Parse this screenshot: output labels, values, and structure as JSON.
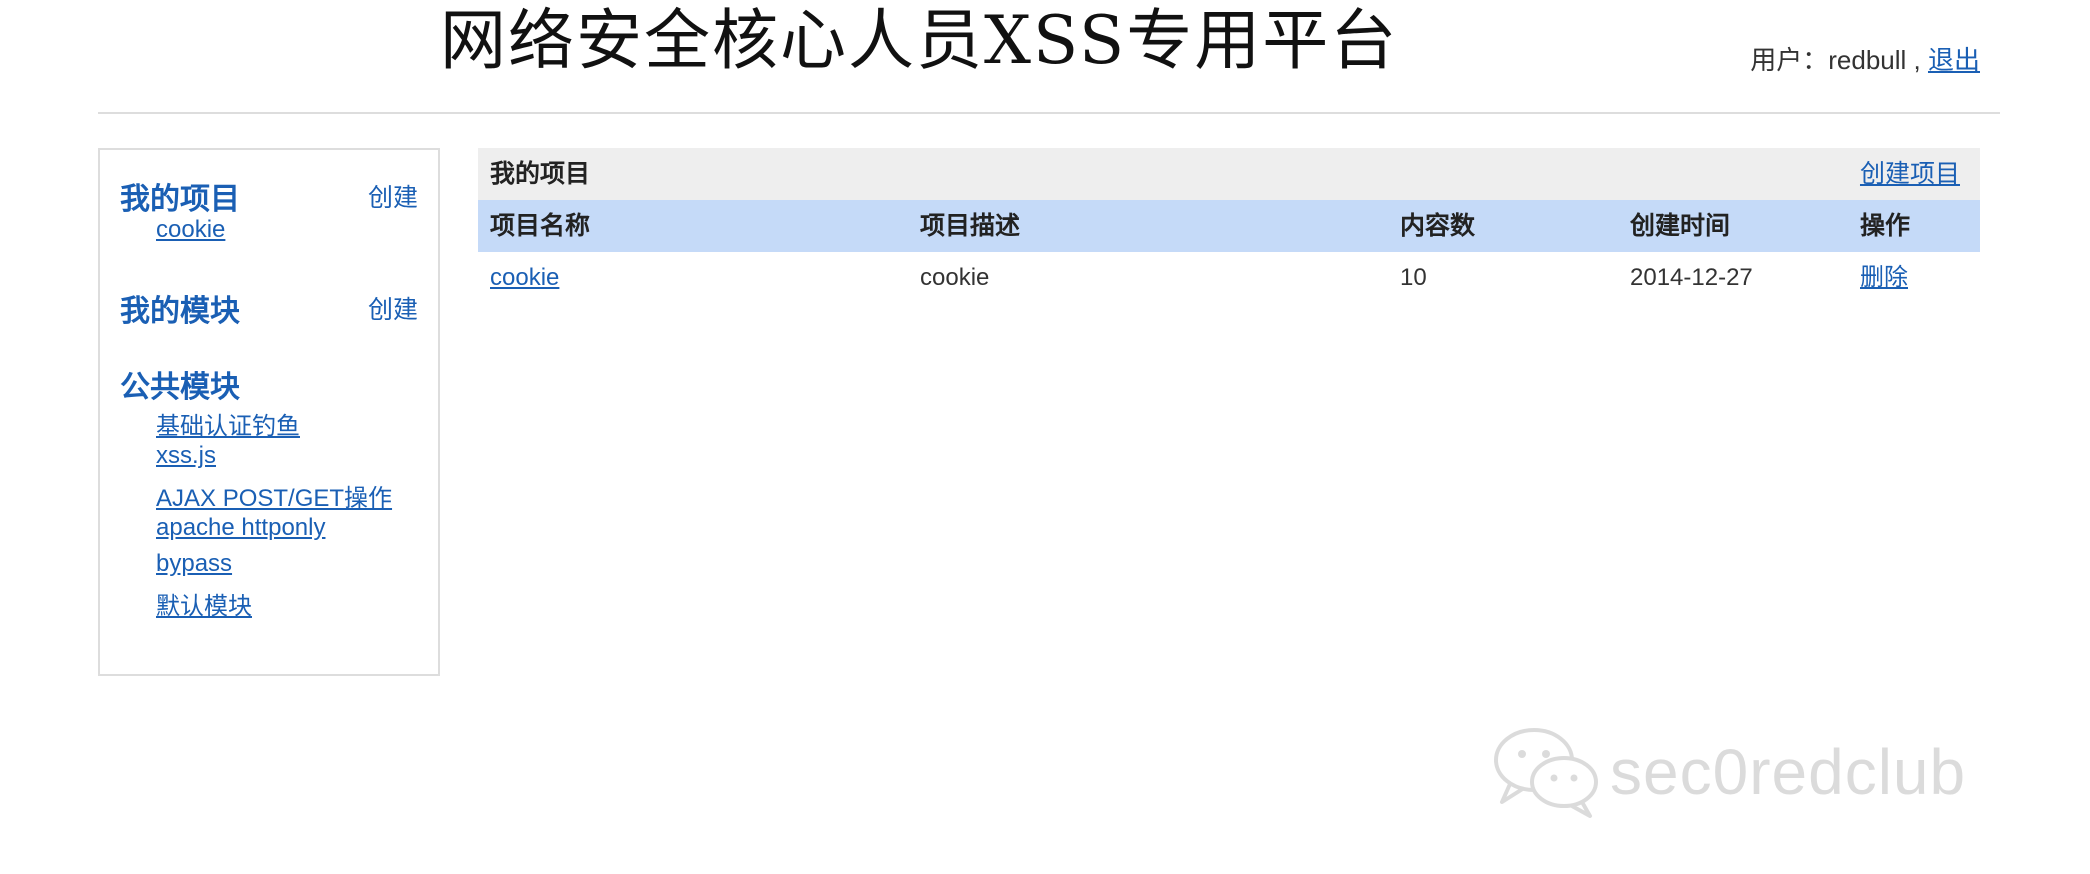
{
  "header": {
    "title": "网络安全核心人员XSS专用平台",
    "user_prefix": "用户：",
    "username": "redbull",
    "separator": " , ",
    "logout_label": "退出"
  },
  "sidebar": {
    "my_projects": {
      "title": "我的项目",
      "create_label": "创建",
      "items": [
        "cookie"
      ]
    },
    "my_modules": {
      "title": "我的模块",
      "create_label": "创建"
    },
    "public_modules": {
      "title": "公共模块",
      "items": [
        "基础认证钓鱼",
        "xss.js",
        "AJAX POST/GET操作",
        "apache httponly",
        "bypass",
        "默认模块"
      ]
    }
  },
  "main": {
    "panel_title": "我的项目",
    "create_project_label": "创建项目",
    "columns": [
      "项目名称",
      "项目描述",
      "内容数",
      "创建时间",
      "操作"
    ],
    "rows": [
      {
        "name": "cookie",
        "description": "cookie",
        "count": "10",
        "created": "2014-12-27",
        "action": "删除"
      }
    ]
  },
  "watermark": {
    "text": "sec0redclub",
    "icon": "wechat-icon"
  }
}
